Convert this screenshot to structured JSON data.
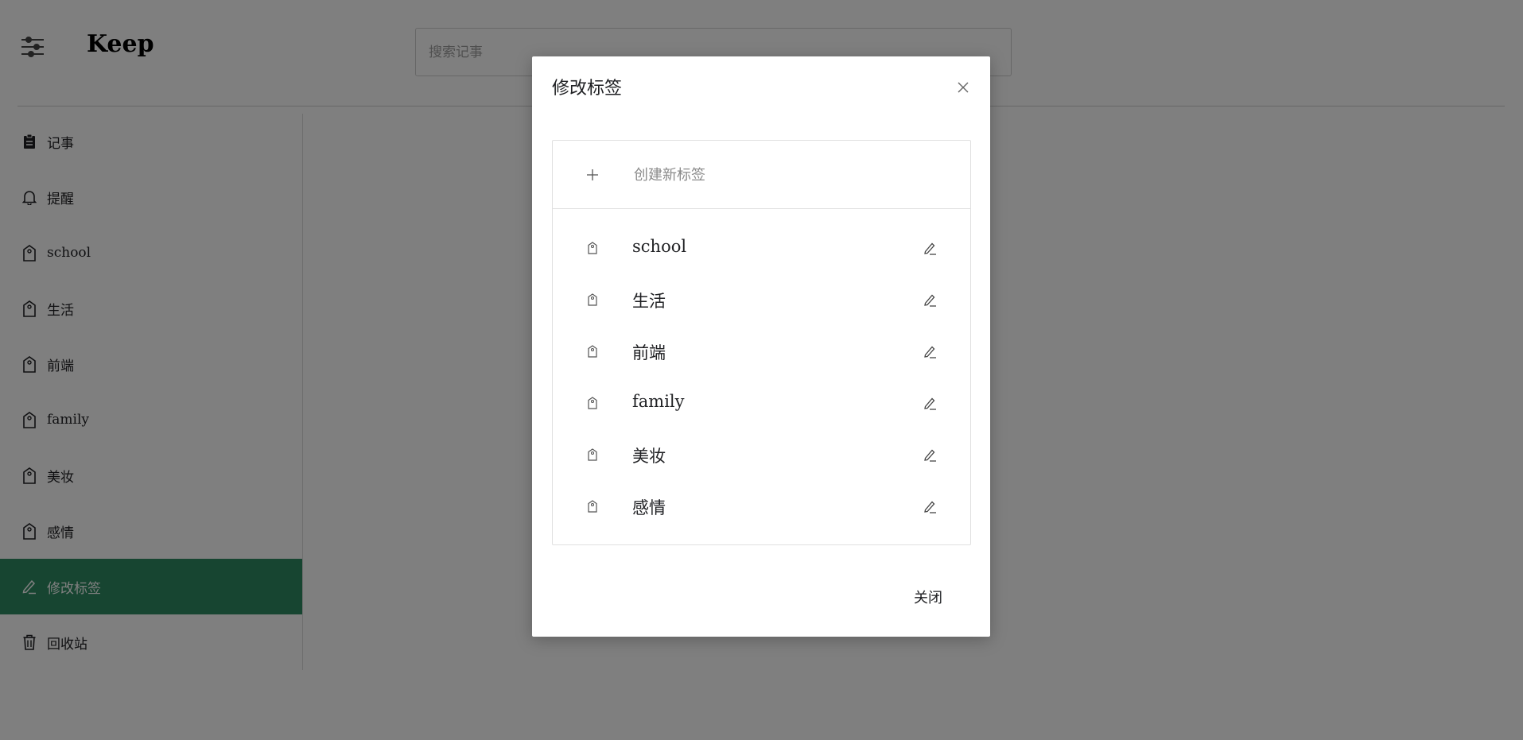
{
  "header": {
    "app_title": "Keep",
    "search_placeholder": "搜索记事"
  },
  "sidebar": {
    "items": [
      {
        "label": "记事",
        "icon": "clipboard-icon"
      },
      {
        "label": "提醒",
        "icon": "bell-icon"
      },
      {
        "label": "school",
        "icon": "tag-icon"
      },
      {
        "label": "生活",
        "icon": "tag-icon"
      },
      {
        "label": "前端",
        "icon": "tag-icon"
      },
      {
        "label": "family",
        "icon": "tag-icon"
      },
      {
        "label": "美妆",
        "icon": "tag-icon"
      },
      {
        "label": "感情",
        "icon": "tag-icon"
      },
      {
        "label": "修改标签",
        "icon": "pencil-icon",
        "active": true
      },
      {
        "label": "回收站",
        "icon": "trash-icon"
      }
    ]
  },
  "modal": {
    "title": "修改标签",
    "create_placeholder": "创建新标签",
    "labels": [
      "school",
      "生活",
      "前端",
      "family",
      "美妆",
      "感情"
    ],
    "close_label": "关闭"
  },
  "colors": {
    "accent": "#2e8b62",
    "overlay": "rgba(0,0,0,0.5)"
  }
}
